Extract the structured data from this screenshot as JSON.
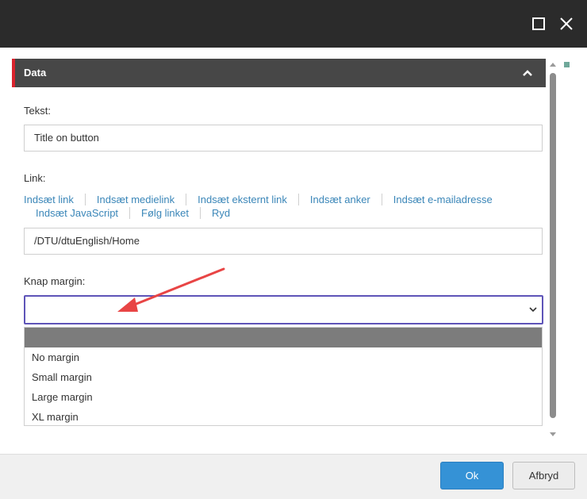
{
  "window": {
    "maximize_icon": "square-maximize-icon",
    "close_icon": "x-close-icon"
  },
  "panel": {
    "title": "Data",
    "accent_color": "#d9232d"
  },
  "form": {
    "text_label": "Tekst:",
    "text_value": "Title on button",
    "link_label": "Link:",
    "link_actions_row1": [
      "Indsæt link",
      "Indsæt medielink",
      "Indsæt eksternt link",
      "Indsæt anker",
      "Indsæt e-mailadresse"
    ],
    "link_actions_row2": [
      "Indsæt JavaScript",
      "Følg linket",
      "Ryd"
    ],
    "link_value": "/DTU/dtuEnglish/Home",
    "margin_label": "Knap margin:",
    "margin_selected": "",
    "margin_options": [
      "",
      "No margin",
      "Small margin",
      "Large margin",
      "XL margin"
    ]
  },
  "footer": {
    "ok_label": "Ok",
    "cancel_label": "Afbryd"
  },
  "colors": {
    "ok_button": "#3592d6",
    "select_focus_border": "#5e54b8",
    "annotation_arrow": "#e84545"
  }
}
